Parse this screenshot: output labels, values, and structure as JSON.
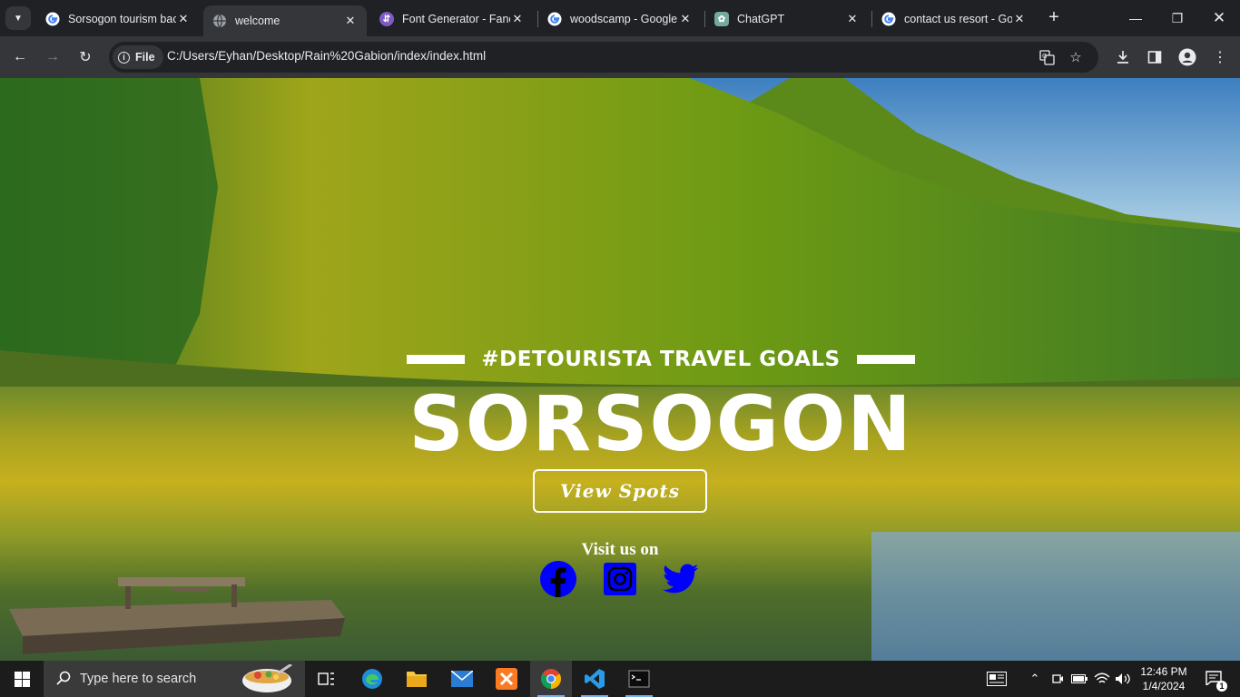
{
  "browser": {
    "tabs": [
      {
        "title": "Sorsogon tourism background",
        "favicon": "google-icon",
        "active": false
      },
      {
        "title": "welcome",
        "favicon": "globe-icon",
        "active": true
      },
      {
        "title": "Font Generator - Fancy",
        "favicon": "font-generator-icon",
        "active": false
      },
      {
        "title": "woodscamp - Google Search",
        "favicon": "google-icon",
        "active": false
      },
      {
        "title": "ChatGPT",
        "favicon": "chatgpt-icon",
        "active": false
      },
      {
        "title": "contact us resort - Google",
        "favicon": "google-icon",
        "active": false
      }
    ],
    "chip_label": "File",
    "url": "C:/Users/Eyhan/Desktop/Rain%20Gabion/index/index.html"
  },
  "hero": {
    "tagline": "#DETOURISTA TRAVEL GOALS",
    "title": "SORSOGON",
    "button_label": "View Spots",
    "visit_label": "Visit us on",
    "social_color": "#0000ff",
    "social": [
      "facebook-icon",
      "instagram-icon",
      "twitter-icon"
    ]
  },
  "taskbar": {
    "search_placeholder": "Type here to search",
    "time": "12:46 PM",
    "date": "1/4/2024",
    "notification_count": "1"
  }
}
